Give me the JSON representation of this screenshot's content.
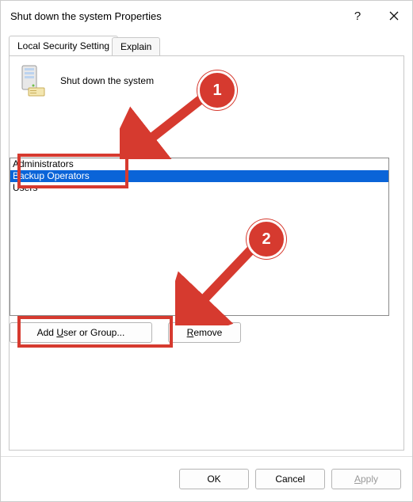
{
  "window": {
    "title": "Shut down the system Properties"
  },
  "tabs": {
    "local_security": "Local Security Setting",
    "explain": "Explain"
  },
  "policy": {
    "title": "Shut down the system"
  },
  "list": {
    "items": [
      "Administrators",
      "Backup Operators",
      "Users"
    ],
    "selected_index": 1
  },
  "buttons": {
    "add": "Add User or Group...",
    "add_underline_char": "U",
    "remove": "Remove",
    "remove_underline_char": "R",
    "ok": "OK",
    "cancel": "Cancel",
    "apply": "Apply",
    "apply_underline_char": "A"
  },
  "annotations": {
    "callout1": "1",
    "callout2": "2",
    "color": "#d63a2f"
  }
}
